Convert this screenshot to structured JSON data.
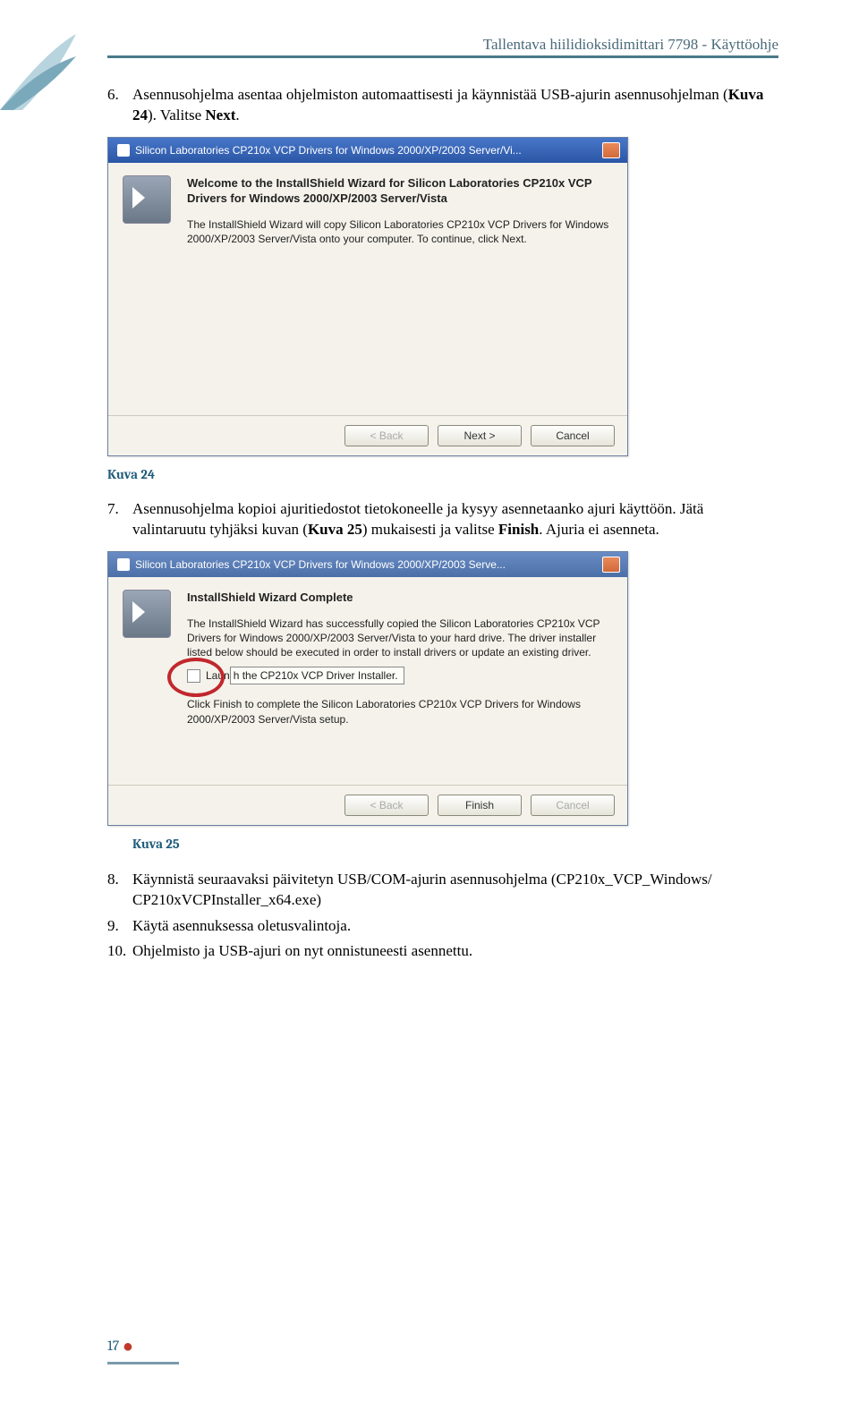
{
  "header": {
    "title": "Tallentava hiilidioksidimittari 7798 - Käyttöohje"
  },
  "steps": {
    "step6_num": "6.",
    "step6": "Asennusohjelma asentaa ohjelmiston automaattisesti ja käynnistää USB-ajurin asennusohjelman (",
    "step6_ref": "Kuva 24",
    "step6_tail1": "). Valitse ",
    "step6_next": "Next",
    "step6_tail2": ".",
    "step7_num": "7.",
    "step7a": "Asennusohjelma kopioi ajuritiedostot tietokoneelle ja kysyy asennetaanko ajuri käyttöön. Jätä valintaruutu tyhjäksi kuvan (",
    "step7_ref": "Kuva 25",
    "step7b": ") mukaisesti ja valitse ",
    "step7_finish": "Finish",
    "step7c": ". Ajuria ei asenneta.",
    "step8_num": "8.",
    "step8": "Käynnistä seuraavaksi päivitetyn USB/COM-ajurin asennusohjelma (CP210x_VCP_Windows/ CP210xVCPInstaller_x64.exe)",
    "step9_num": "9.",
    "step9": "Käytä asennuksessa oletusvalintoja.",
    "step10_num": "10.",
    "step10": "Ohjelmisto ja USB-ajuri on nyt onnistuneesti asennettu."
  },
  "captions": {
    "fig24": "Kuva 24",
    "fig25": "Kuva 25"
  },
  "dialog24": {
    "title": "Silicon Laboratories CP210x VCP Drivers for Windows 2000/XP/2003 Server/Vi...",
    "heading": "Welcome to the InstallShield Wizard for Silicon Laboratories CP210x VCP Drivers for Windows 2000/XP/2003 Server/Vista",
    "body": "The InstallShield Wizard will copy Silicon Laboratories CP210x VCP Drivers for Windows 2000/XP/2003 Server/Vista onto your computer. To continue, click Next.",
    "back": "< Back",
    "next": "Next >",
    "cancel": "Cancel"
  },
  "dialog25": {
    "title": "Silicon Laboratories CP210x VCP Drivers for Windows 2000/XP/2003 Serve...",
    "heading": "InstallShield Wizard Complete",
    "body1": "The InstallShield Wizard has successfully copied the Silicon Laboratories CP210x VCP Drivers for Windows 2000/XP/2003 Server/Vista to your hard drive. The driver installer listed below should be executed in order to install drivers or update an existing driver.",
    "launch_left": "Laun",
    "launch_right": "h the CP210x VCP Driver Installer.",
    "body2": "Click Finish to complete the Silicon Laboratories CP210x VCP Drivers for Windows 2000/XP/2003 Server/Vista setup.",
    "back": "< Back",
    "finish": "Finish",
    "cancel": "Cancel"
  },
  "page_number": "17"
}
